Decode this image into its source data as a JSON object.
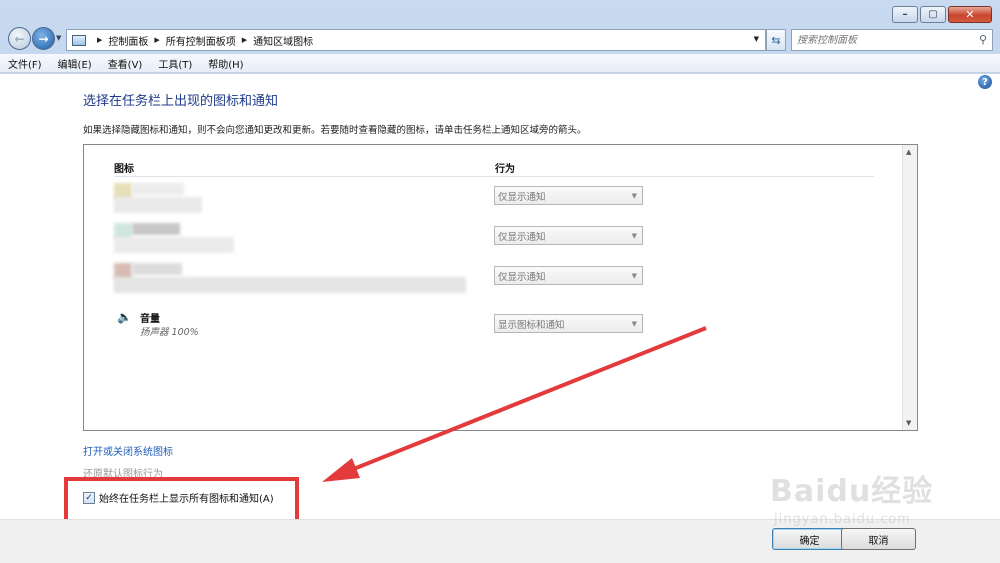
{
  "window": {
    "caption": {
      "minimize_glyph": "–",
      "maximize_glyph": "▢",
      "close_glyph": "✕"
    }
  },
  "address_bar": {
    "breadcrumbs": [
      "控制面板",
      "所有控制面板项",
      "通知区域图标"
    ],
    "search_placeholder": "搜索控制面板"
  },
  "menu": {
    "items": [
      "文件(F)",
      "编辑(E)",
      "查看(V)",
      "工具(T)",
      "帮助(H)"
    ]
  },
  "main": {
    "title": "选择在任务栏上出现的图标和通知",
    "description": "如果选择隐藏图标和通知，则不会向您通知更改和更新。若要随时查看隐藏的图标，请单击任务栏上通知区域旁的箭头。",
    "columns": {
      "icon": "图标",
      "behavior": "行为"
    },
    "rows": [
      {
        "behavior": "仅显示通知"
      },
      {
        "behavior": "仅显示通知"
      },
      {
        "behavior": "仅显示通知"
      }
    ],
    "speaker": {
      "name": "音量",
      "desc": "扬声器 100%",
      "behavior": "显示图标和通知"
    },
    "links": {
      "system_icons": "打开或关闭系统图标",
      "restore_default": "还原默认图标行为"
    },
    "always_show": {
      "label": "始终在任务栏上显示所有图标和通知(A)",
      "checked": true
    }
  },
  "buttons": {
    "ok": "确定",
    "cancel": "取消"
  },
  "annotation": {
    "color": "#e33b3b"
  },
  "watermark": {
    "text": "Baidu经验",
    "sub": "jingyan.baidu.com"
  }
}
